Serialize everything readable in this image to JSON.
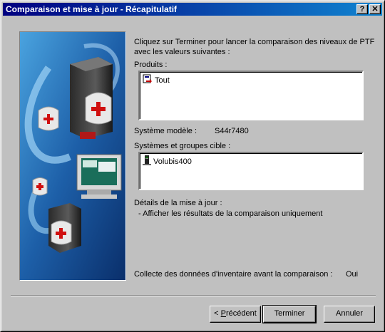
{
  "window": {
    "title": "Comparaison et mise à jour - Récapitulatif",
    "help_label": "?",
    "close_label": "✕"
  },
  "intro": {
    "line1": "Cliquez sur Terminer pour lancer la comparaison des niveaux de PTF",
    "line2": "avec les valeurs suivantes :"
  },
  "products": {
    "label": "Produits :",
    "items": [
      "Tout"
    ]
  },
  "model_system": {
    "label": "Système modèle :",
    "value": "S44r7480"
  },
  "targets": {
    "label": "Systèmes et groupes cible :",
    "items": [
      "Volubis400"
    ]
  },
  "update_details": {
    "label": "Détails de la mise à jour :",
    "value": "- Afficher les résultats de la comparaison uniquement"
  },
  "inventory": {
    "label": "Collecte des données d'inventaire avant la comparaison :",
    "value": "Oui"
  },
  "buttons": {
    "back_prefix": "< ",
    "back_mnemonic": "P",
    "back_rest": "récédent",
    "finish": "Terminer",
    "cancel": "Annuler"
  },
  "colors": {
    "titlebar_start": "#000080",
    "titlebar_end": "#1084d0",
    "face": "#c0c0c0",
    "art_blue": "#1d5fa8"
  }
}
